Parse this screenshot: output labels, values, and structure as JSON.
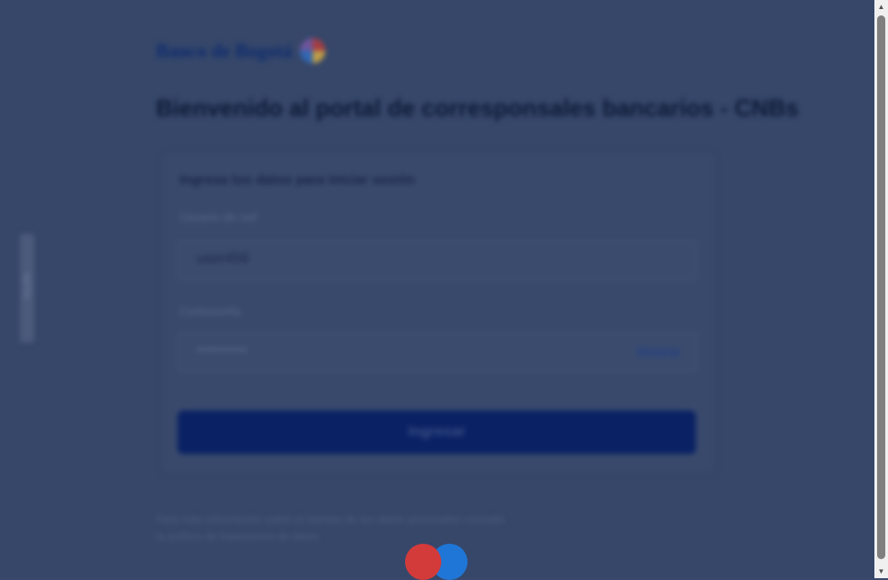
{
  "header": {
    "bank_name": "Banco de Bogotá"
  },
  "page_title": "Bienvenido al portal de corresponsales bancarios - CNBs",
  "side_tab": {
    "label": "Ayuda"
  },
  "login_form": {
    "subtitle": "Ingresa tus datos para iniciar sesión",
    "username_label": "Usuario de red",
    "username_value": "user456",
    "password_label": "Contraseña",
    "password_placeholder": "••••••••••",
    "show_password_label": "Mostrar",
    "submit_label": "Ingresar"
  },
  "footer": {
    "line1": "Para más información sobre el manejo de tus datos personales consulta",
    "line2": "la política de tratamiento de datos"
  },
  "colors": {
    "overlay": "#36476a",
    "brand_blue": "#0a2264",
    "spinner_red": "#d33b3b",
    "spinner_blue": "#1f76d6"
  }
}
